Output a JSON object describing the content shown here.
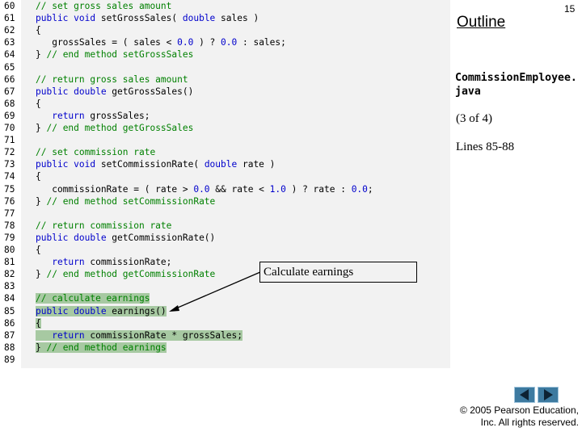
{
  "header": {
    "outline": "Outline",
    "page_number": "15",
    "filename": "CommissionEmployee.java",
    "page_of": "(3 of 4)",
    "lines_ref": "Lines 85-88"
  },
  "callout": {
    "text": "Calculate earnings"
  },
  "footer": {
    "copyright_line1": "© 2005 Pearson Education,",
    "copyright_line2": "Inc.  All rights reserved."
  },
  "navigation": {
    "prev_icon": "left-triangle-icon",
    "next_icon": "right-triangle-icon",
    "button_color": "#3d7aa0"
  },
  "code": {
    "highlight_color": "#a7c9a2",
    "lines": [
      {
        "n": "60",
        "segs": [
          [
            "cm",
            "// set gross sales amount"
          ]
        ]
      },
      {
        "n": "61",
        "segs": [
          [
            "kw",
            "public void "
          ],
          [
            "tx",
            "setGrossSales( "
          ],
          [
            "kw",
            "double "
          ],
          [
            "tx",
            "sales )"
          ]
        ]
      },
      {
        "n": "62",
        "segs": [
          [
            "tx",
            "{"
          ]
        ]
      },
      {
        "n": "63",
        "segs": [
          [
            "tx",
            "   grossSales = ( sales < "
          ],
          [
            "num",
            "0.0"
          ],
          [
            "tx",
            " ) ? "
          ],
          [
            "num",
            "0.0"
          ],
          [
            "tx",
            " : sales;"
          ]
        ]
      },
      {
        "n": "64",
        "segs": [
          [
            "tx",
            "} "
          ],
          [
            "cm",
            "// end method setGrossSales"
          ]
        ]
      },
      {
        "n": "65",
        "segs": []
      },
      {
        "n": "66",
        "segs": [
          [
            "cm",
            "// return gross sales amount"
          ]
        ]
      },
      {
        "n": "67",
        "segs": [
          [
            "kw",
            "public double "
          ],
          [
            "tx",
            "getGrossSales()"
          ]
        ]
      },
      {
        "n": "68",
        "segs": [
          [
            "tx",
            "{"
          ]
        ]
      },
      {
        "n": "69",
        "segs": [
          [
            "tx",
            "   "
          ],
          [
            "kw",
            "return "
          ],
          [
            "tx",
            "grossSales;"
          ]
        ]
      },
      {
        "n": "70",
        "segs": [
          [
            "tx",
            "} "
          ],
          [
            "cm",
            "// end method getGrossSales"
          ]
        ]
      },
      {
        "n": "71",
        "segs": []
      },
      {
        "n": "72",
        "segs": [
          [
            "cm",
            "// set commission rate"
          ]
        ]
      },
      {
        "n": "73",
        "segs": [
          [
            "kw",
            "public void "
          ],
          [
            "tx",
            "setCommissionRate( "
          ],
          [
            "kw",
            "double "
          ],
          [
            "tx",
            "rate )"
          ]
        ]
      },
      {
        "n": "74",
        "segs": [
          [
            "tx",
            "{"
          ]
        ]
      },
      {
        "n": "75",
        "segs": [
          [
            "tx",
            "   commissionRate = ( rate > "
          ],
          [
            "num",
            "0.0"
          ],
          [
            "tx",
            " && rate < "
          ],
          [
            "num",
            "1.0"
          ],
          [
            "tx",
            " ) ? rate : "
          ],
          [
            "num",
            "0.0"
          ],
          [
            "tx",
            ";"
          ]
        ]
      },
      {
        "n": "76",
        "segs": [
          [
            "tx",
            "} "
          ],
          [
            "cm",
            "// end method setCommissionRate"
          ]
        ]
      },
      {
        "n": "77",
        "segs": []
      },
      {
        "n": "78",
        "segs": [
          [
            "cm",
            "// return commission rate"
          ]
        ]
      },
      {
        "n": "79",
        "segs": [
          [
            "kw",
            "public double "
          ],
          [
            "tx",
            "getCommissionRate()"
          ]
        ]
      },
      {
        "n": "80",
        "segs": [
          [
            "tx",
            "{"
          ]
        ]
      },
      {
        "n": "81",
        "segs": [
          [
            "tx",
            "   "
          ],
          [
            "kw",
            "return "
          ],
          [
            "tx",
            "commissionRate;"
          ]
        ]
      },
      {
        "n": "82",
        "segs": [
          [
            "tx",
            "} "
          ],
          [
            "cm",
            "// end method getCommissionRate"
          ]
        ]
      },
      {
        "n": "83",
        "segs": []
      },
      {
        "n": "84",
        "hl": true,
        "segs": [
          [
            "cm",
            "// calculate earnings"
          ]
        ]
      },
      {
        "n": "85",
        "hl": true,
        "segs": [
          [
            "kw",
            "public double "
          ],
          [
            "tx",
            "earnings()"
          ]
        ]
      },
      {
        "n": "86",
        "hl": true,
        "segs": [
          [
            "tx",
            "{"
          ]
        ]
      },
      {
        "n": "87",
        "hl": true,
        "segs": [
          [
            "tx",
            "   "
          ],
          [
            "kw",
            "return "
          ],
          [
            "tx",
            "commissionRate * grossSales;"
          ]
        ]
      },
      {
        "n": "88",
        "hl": true,
        "segs": [
          [
            "tx",
            "} "
          ],
          [
            "cm",
            "// end method earnings"
          ]
        ]
      },
      {
        "n": "89",
        "segs": []
      }
    ]
  }
}
